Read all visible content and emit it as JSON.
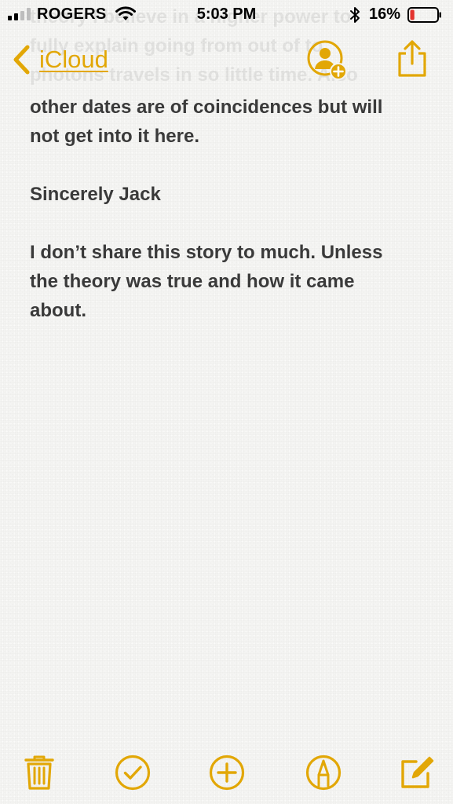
{
  "status_bar": {
    "carrier": "ROGERS",
    "time": "5:03 PM",
    "battery_percent": "16%",
    "battery_level": 0.16,
    "signal_bars_filled": 2,
    "signal_bars_total": 4
  },
  "nav": {
    "back_label": "iCloud"
  },
  "note": {
    "faded_text": "theory I believe in a higher power to\nfully explain going from out of to\nphotons travels in so little time. Also",
    "paragraphs": [
      "other dates are of coincidences but will\nnot get into it here.",
      "Sincerely Jack",
      "I don’t share this story to much. Unless\nthe theory was true and how it came\nabout."
    ]
  },
  "icons": {
    "back": "chevron-left-icon",
    "add_people": "add-people-icon",
    "share": "share-icon",
    "trash": "trash-icon",
    "checklist": "checkmark-circle-icon",
    "add": "plus-circle-icon",
    "markup": "markup-pen-icon",
    "compose": "compose-icon"
  },
  "colors": {
    "accent": "#e2a706",
    "text": "#3a3a3a",
    "background": "#f4f4f2",
    "battery_low": "#e3342f"
  }
}
